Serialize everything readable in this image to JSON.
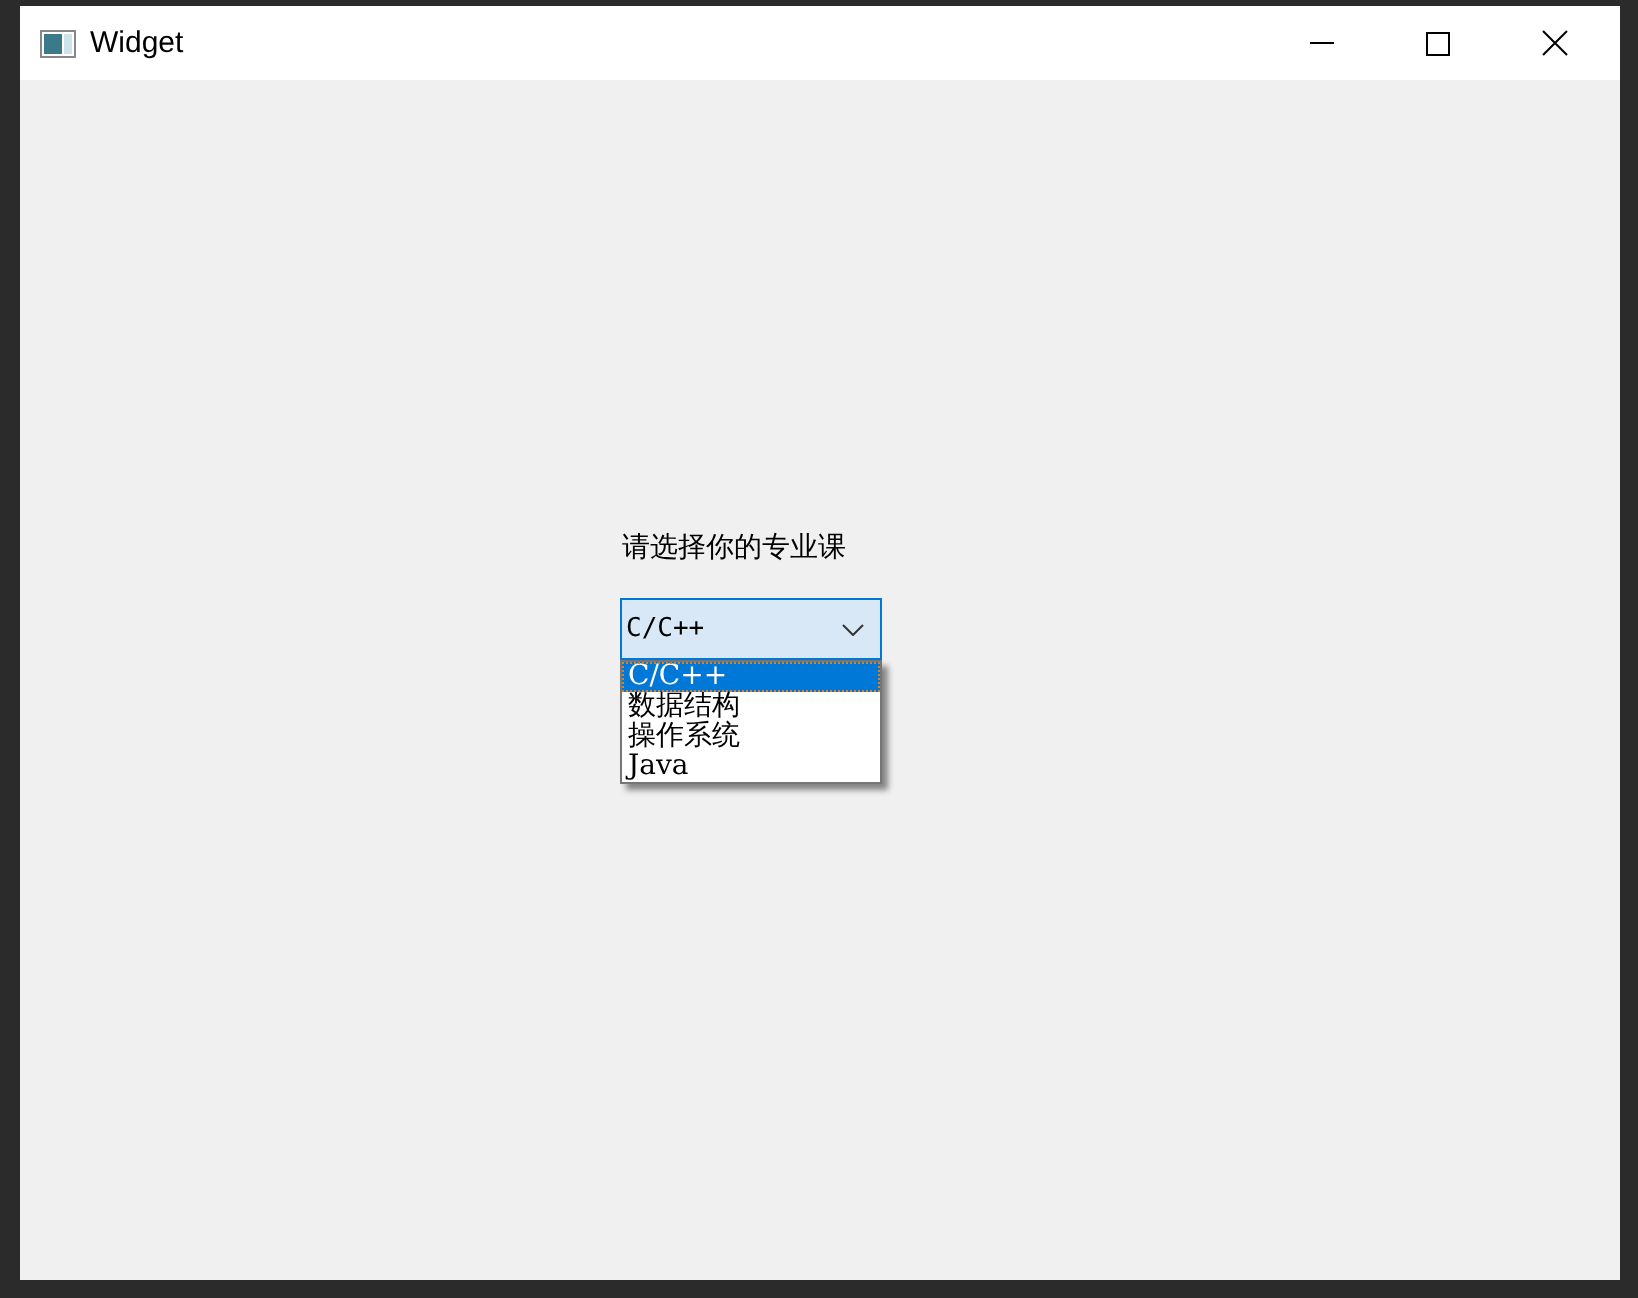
{
  "window": {
    "title": "Widget"
  },
  "label": "请选择你的专业课",
  "combo": {
    "value": "C/C++",
    "expanded": true,
    "options": [
      {
        "label": "C/C++",
        "selected": true
      },
      {
        "label": "数据结构",
        "selected": false
      },
      {
        "label": "操作系统",
        "selected": false
      },
      {
        "label": "Java",
        "selected": false
      }
    ]
  }
}
